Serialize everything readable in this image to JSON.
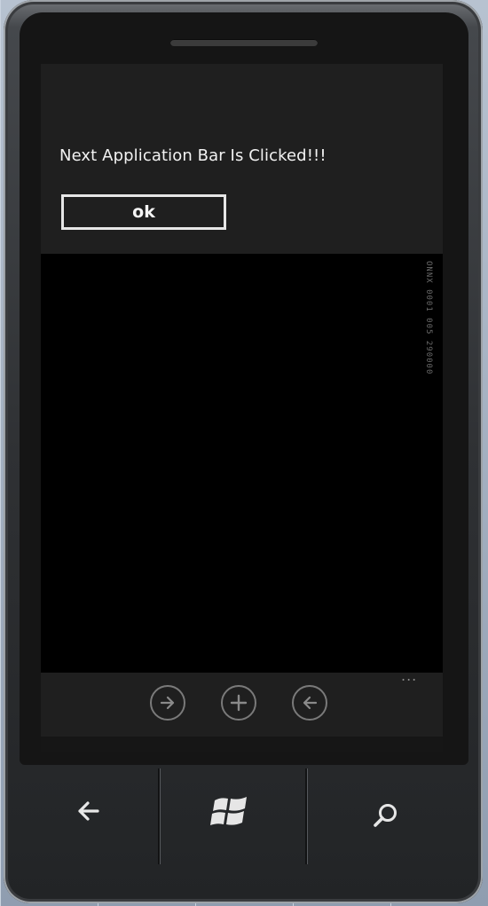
{
  "dialog": {
    "message": "Next Application Bar Is Clicked!!!",
    "ok_label": "ok"
  },
  "screen_side_text": "ONNX 0001 005 290000",
  "app_bar": {
    "buttons": [
      {
        "icon": "arrow-right-icon"
      },
      {
        "icon": "plus-icon"
      },
      {
        "icon": "arrow-left-icon"
      }
    ],
    "more_label": "..."
  },
  "hardware_buttons": [
    {
      "icon": "back-arrow-icon"
    },
    {
      "icon": "windows-start-icon"
    },
    {
      "icon": "search-icon"
    }
  ],
  "colors": {
    "screen_bg": "#000000",
    "dialog_bg": "#1f1f1f",
    "text": "#f2f2f2",
    "icon_stroke": "#7a7a7a"
  }
}
